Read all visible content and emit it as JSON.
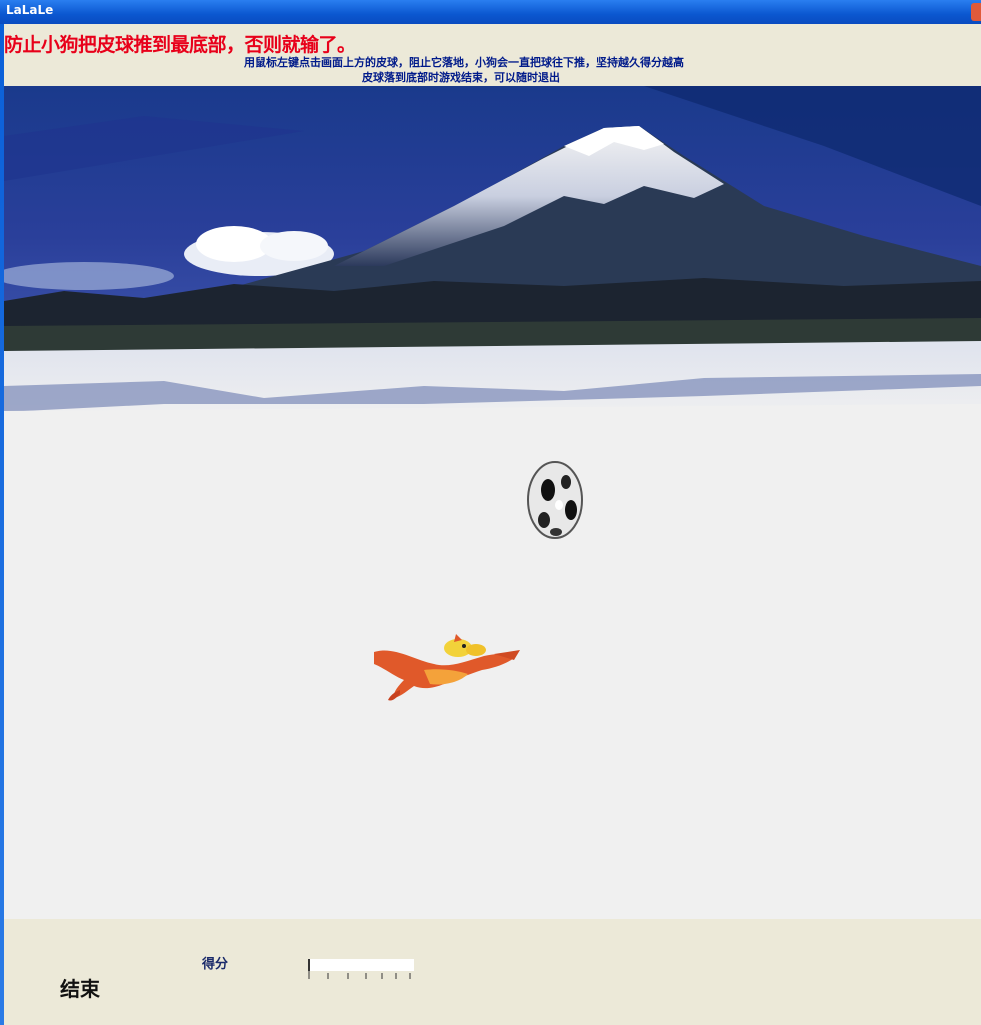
{
  "window": {
    "title": "LaLaLe"
  },
  "header": {
    "warning": "防止小狗把皮球推到最底部，否则就输了。",
    "instruction_line1": "用鼠标左键点击画面上方的皮球，阻止它落地，小狗会一直把球往下推，坚持越久得分越高",
    "instruction_line2": "皮球落到底部时游戏结束，可以随时退出"
  },
  "game": {
    "sprites": {
      "ball": "soccer-ball",
      "dog": "orange-dog"
    },
    "colors": {
      "sky": "#1b2f8a",
      "snow": "#f0f0f0",
      "warning": "#e8001a"
    }
  },
  "status": {
    "exit_label": "结束",
    "score_label": "得分",
    "progress": 0
  }
}
